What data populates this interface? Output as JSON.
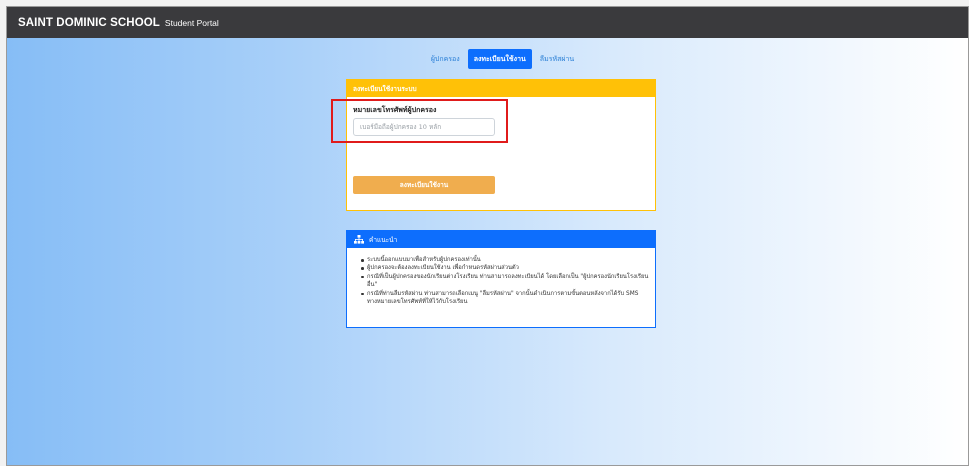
{
  "header": {
    "brand": "SAINT DOMINIC SCHOOL",
    "subtitle": "Student Portal"
  },
  "tabs": [
    {
      "label": "ผู้ปกครอง",
      "active": false
    },
    {
      "label": "ลงทะเบียนใช้งาน",
      "active": true
    },
    {
      "label": "ลืมรหัสผ่าน",
      "active": false
    }
  ],
  "register_card": {
    "title": "ลงทะเบียนใช้งานระบบ",
    "field_label": "หมายเลขโทรศัพท์ผู้ปกครอง",
    "phone_placeholder": "เบอร์มือถือผู้ปกครอง 10 หลัก",
    "phone_value": "",
    "submit_label": "ลงทะเบียนใช้งาน"
  },
  "info_card": {
    "icon": "sitemap-icon",
    "title": "คำแนะนำ",
    "items": [
      "ระบบนี้ออกแบบมาเพื่อสำหรับผู้ปกครองเท่านั้น",
      "ผู้ปกครองจะต้องลงทะเบียนใช้งาน เพื่อกำหนดรหัสผ่านส่วนตัว",
      "กรณีที่เป็นผู้ปกครองของนักเรียนต่างโรงเรียน ท่านสามารถลงทะเบียนได้ โดยเลือกเป็น \"ผู้ปกครองนักเรียนโรงเรียนอื่น\"",
      "กรณีที่ท่านลืมรหัสผ่าน ท่านสามารถเลือกเมนู \"ลืมรหัสผ่าน\" จากนั้นดำเนินการตามขั้นตอนหลังจากได้รับ SMS ทางหมายเลขโทรศัพท์ที่ให้ไว้กับโรงเรียน"
    ]
  },
  "colors": {
    "navbar": "#3a3a3d",
    "warning": "#ffc107",
    "button": "#f0ad4e",
    "primary": "#0d6efd",
    "highlight": "#e01b1b"
  }
}
